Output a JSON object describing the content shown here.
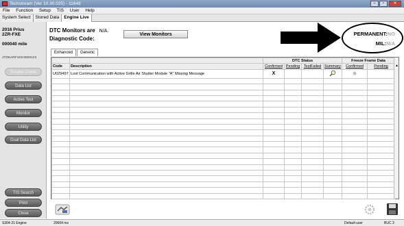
{
  "window": {
    "title": "Techstream (Ver 10.30.025) - 11648",
    "minimize": "–",
    "maximize": "▫",
    "close": "✕"
  },
  "menu": [
    "File",
    "Function",
    "Setup",
    "TIS",
    "User",
    "Help"
  ],
  "tabs": [
    "System Select",
    "Stored Data",
    "Engine Live"
  ],
  "vehicle": {
    "year_model": "2016 Prius",
    "engine": "2ZR-FXE",
    "mileage": "000040 mile",
    "vin": "JTDKARFU0G3500123"
  },
  "sidebar_buttons": [
    {
      "label": "Trouble Codes",
      "enabled": false
    },
    {
      "label": "Data List",
      "enabled": true
    },
    {
      "label": "Active Test",
      "enabled": true
    },
    {
      "label": "Monitor",
      "enabled": true
    },
    {
      "label": "Utility",
      "enabled": true
    },
    {
      "label": "Dual Data List",
      "enabled": true
    }
  ],
  "sidebar_bottom": [
    "TIS Search",
    "Print",
    "Close"
  ],
  "header": {
    "monitors_label": "DTC Monitors are",
    "monitors_value": "N/A.",
    "view_button": "View Monitors",
    "diag_label": "Diagnostic Code:"
  },
  "subtabs": [
    "Enhanced",
    "Generic"
  ],
  "permanent": {
    "label": "PERMANENT:",
    "value": "NO"
  },
  "mil": {
    "label": "MIL:",
    "value": "N/A"
  },
  "table": {
    "group_headers": {
      "dtc_status": "DTC Status",
      "freeze": "Freeze Frame Data"
    },
    "columns": {
      "code": "Code",
      "description": "Description",
      "confirmed": "Confirmed",
      "pending": "Pending",
      "testfailed": "TestFailed",
      "summary": "Summary",
      "ff_confirmed": "Confirmed",
      "ff_pending": "Pending"
    },
    "rows": [
      {
        "code": "U029497",
        "description": "Lost Communication with Active Grille Air Shutter Module \"A\" Missing Message",
        "confirmed": "X",
        "pending": "",
        "testfailed": "",
        "summary": "magnifier-icon",
        "ff_confirmed": "dot",
        "ff_pending": ""
      }
    ]
  },
  "status": {
    "left": "S304-21  Engine",
    "mid": "20664 ms",
    "user": "Default user",
    "right": "BUC 3"
  },
  "colors": {
    "title_bar": "#7b96b9",
    "button_dark": "#6a6a6a"
  }
}
